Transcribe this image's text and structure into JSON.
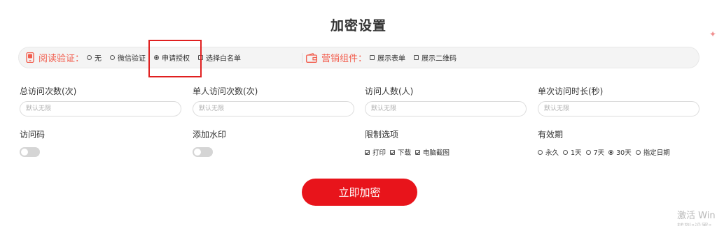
{
  "page": {
    "title": "加密设置"
  },
  "read_verify": {
    "label": "阅读验证：",
    "options": [
      {
        "label": "无",
        "selected": false
      },
      {
        "label": "微信验证",
        "selected": false
      },
      {
        "label": "申请授权",
        "selected": true
      }
    ],
    "whitelist": {
      "label": "选择白名单",
      "checked": false
    }
  },
  "marketing": {
    "label": "营销组件：",
    "options": [
      {
        "label": "展示表单",
        "checked": false
      },
      {
        "label": "展示二维码",
        "checked": false
      }
    ]
  },
  "fields": {
    "total_visits": {
      "label": "总访问次数(次)",
      "placeholder": "默认无限"
    },
    "single_visits": {
      "label": "单人访问次数(次)",
      "placeholder": "默认无限"
    },
    "visitors": {
      "label": "访问人数(人)",
      "placeholder": "默认无限"
    },
    "duration": {
      "label": "单次访问时长(秒)",
      "placeholder": "默认无限"
    },
    "access_code": {
      "label": "访问码",
      "enabled": false
    },
    "watermark": {
      "label": "添加水印",
      "enabled": false
    }
  },
  "restrictions": {
    "label": "限制选项",
    "options": [
      {
        "label": "打印",
        "checked": true
      },
      {
        "label": "下载",
        "checked": true
      },
      {
        "label": "电脑截图",
        "checked": true
      }
    ]
  },
  "validity": {
    "label": "有效期",
    "options": [
      {
        "label": "永久",
        "selected": false
      },
      {
        "label": "1天",
        "selected": false
      },
      {
        "label": "7天",
        "selected": false
      },
      {
        "label": "30天",
        "selected": true
      },
      {
        "label": "指定日期",
        "selected": false
      }
    ]
  },
  "submit": {
    "label": "立即加密"
  },
  "watermark_overlay": {
    "line1": "激活 Win",
    "line2": "转到\"设置\""
  },
  "colors": {
    "accent": "#e8141b",
    "label_red": "#f25c4c",
    "highlight": "#e02020"
  }
}
